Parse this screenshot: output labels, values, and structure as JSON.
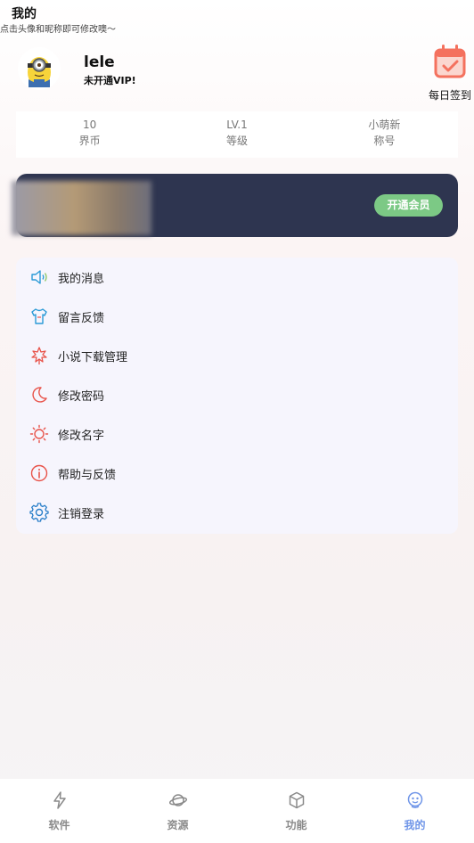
{
  "header": {
    "title": "我的",
    "hint": "点击头像和昵称即可修改噢～"
  },
  "profile": {
    "username": "lele",
    "vip_status": "未开通VIP!",
    "avatar_icon": "minion-avatar-icon"
  },
  "checkin": {
    "label": "每日签到",
    "icon": "calendar-check-icon",
    "color": "#f4715e"
  },
  "stats": [
    {
      "value": "10",
      "label": "界币"
    },
    {
      "value": "LV.1",
      "label": "等级"
    },
    {
      "value": "小萌新",
      "label": "称号"
    }
  ],
  "vip_banner": {
    "button_label": "开通会员",
    "background": "#2e3550",
    "button_color": "#7cc985"
  },
  "menu": [
    {
      "label": "我的消息",
      "icon": "speaker-icon",
      "color": "#2a9ad6"
    },
    {
      "label": "留言反馈",
      "icon": "tshirt-icon",
      "color": "#2a9ad6"
    },
    {
      "label": "小说下载管理",
      "icon": "maple-leaf-icon",
      "color": "#e8534a"
    },
    {
      "label": "修改密码",
      "icon": "moon-icon",
      "color": "#e8534a"
    },
    {
      "label": "修改名字",
      "icon": "sun-icon",
      "color": "#e8534a"
    },
    {
      "label": "帮助与反馈",
      "icon": "info-icon",
      "color": "#e8534a"
    },
    {
      "label": "注销登录",
      "icon": "gear-icon",
      "color": "#2a7fc9"
    }
  ],
  "tabs": [
    {
      "label": "软件",
      "icon": "lightning-icon",
      "active": false
    },
    {
      "label": "资源",
      "icon": "planet-icon",
      "active": false
    },
    {
      "label": "功能",
      "icon": "cube-icon",
      "active": false
    },
    {
      "label": "我的",
      "icon": "robot-face-icon",
      "active": true
    }
  ],
  "colors": {
    "tab_active": "#6f95e8",
    "tab_inactive": "#8a8a8a"
  }
}
